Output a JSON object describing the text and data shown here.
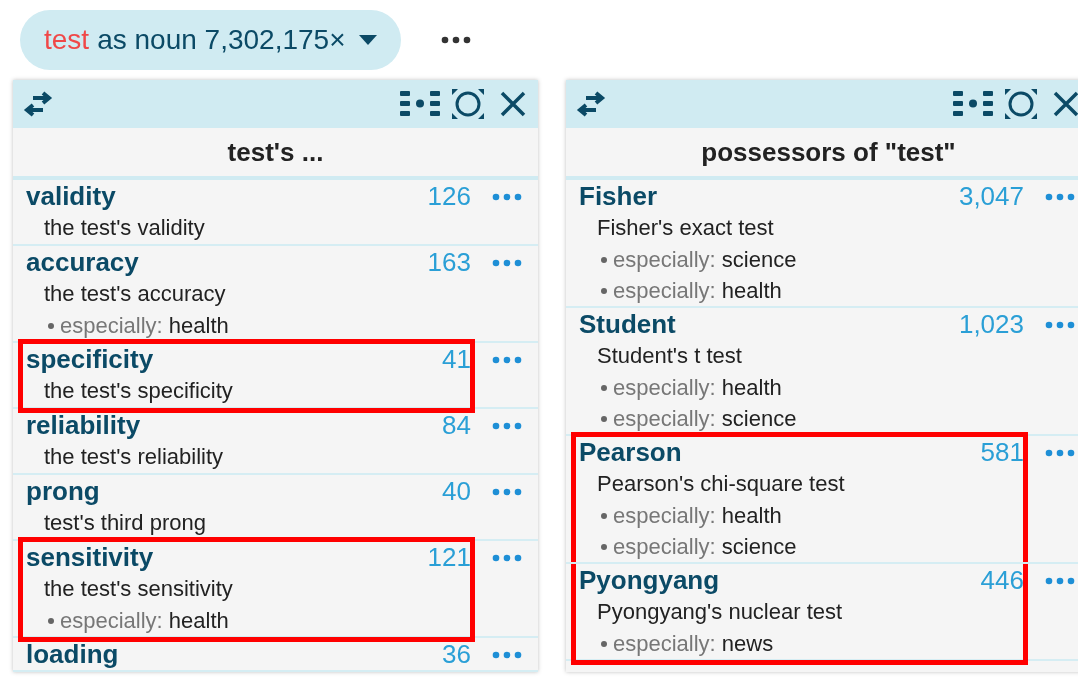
{
  "query": {
    "word": "test",
    "rest": "as noun 7,302,175×"
  },
  "panels": [
    {
      "title": "test's ...",
      "items": [
        {
          "name": "validity",
          "count": "126",
          "phrase": "the test's validity",
          "highlighted": false
        },
        {
          "name": "accuracy",
          "count": "163",
          "phrase": "the test's accuracy",
          "highlighted": false,
          "notes": [
            {
              "label": "especially:",
              "value": "health"
            }
          ]
        },
        {
          "name": "specificity",
          "count": "41",
          "phrase": "the test's specificity",
          "highlighted": true
        },
        {
          "name": "reliability",
          "count": "84",
          "phrase": "the test's reliability",
          "highlighted": false
        },
        {
          "name": "prong",
          "count": "40",
          "phrase": "test's third prong",
          "highlighted": false
        },
        {
          "name": "sensitivity",
          "count": "121",
          "phrase": "the test's sensitivity",
          "highlighted": true,
          "notes": [
            {
              "label": "especially:",
              "value": "health"
            }
          ]
        },
        {
          "name": "loading",
          "count": "36",
          "highlighted": false
        }
      ]
    },
    {
      "title": "possessors of \"test\"",
      "items": [
        {
          "name": "Fisher",
          "count": "3,047",
          "phrase": "Fisher's exact test",
          "highlighted": false,
          "notes": [
            {
              "label": "especially:",
              "value": "science"
            },
            {
              "label": "especially:",
              "value": "health"
            }
          ]
        },
        {
          "name": "Student",
          "count": "1,023",
          "phrase": "Student's t test",
          "highlighted": false,
          "notes": [
            {
              "label": "especially:",
              "value": "health"
            },
            {
              "label": "especially:",
              "value": "science"
            }
          ]
        },
        {
          "name": "Pearson",
          "count": "581",
          "phrase": "Pearson's chi-square test",
          "highlighted": true,
          "notes": [
            {
              "label": "especially:",
              "value": "health"
            },
            {
              "label": "especially:",
              "value": "science"
            }
          ]
        },
        {
          "name": "Pyongyang",
          "count": "446",
          "phrase": "Pyongyang's nuclear test",
          "highlighted": true,
          "notes": [
            {
              "label": "especially:",
              "value": "news"
            }
          ]
        }
      ]
    }
  ]
}
